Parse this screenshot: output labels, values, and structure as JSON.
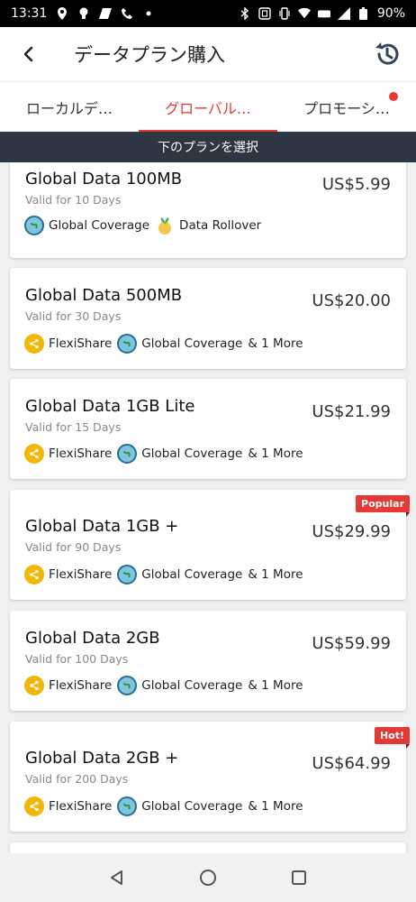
{
  "status_bar": {
    "time": "13:31",
    "battery": "90%"
  },
  "header": {
    "title": "データプラン購入"
  },
  "tabs": [
    {
      "label": "ローカルデ…"
    },
    {
      "label": "グローバル…"
    },
    {
      "label": "プロモーシ…"
    }
  ],
  "section_label": "下のプランを選択",
  "plans": [
    {
      "name": "Global Data 100MB",
      "validity": "Valid for 10 Days",
      "price": "US$5.99",
      "features": [
        "Global Coverage",
        "Data Rollover"
      ],
      "more": "",
      "badge": ""
    },
    {
      "name": "Global Data 500MB",
      "validity": "Valid for 30 Days",
      "price": "US$20.00",
      "features": [
        "FlexiShare",
        "Global Coverage"
      ],
      "more": "& 1 More",
      "badge": ""
    },
    {
      "name": "Global Data 1GB Lite",
      "validity": "Valid for 15 Days",
      "price": "US$21.99",
      "features": [
        "FlexiShare",
        "Global Coverage"
      ],
      "more": "& 1 More",
      "badge": ""
    },
    {
      "name": "Global Data 1GB +",
      "validity": "Valid for 90 Days",
      "price": "US$29.99",
      "features": [
        "FlexiShare",
        "Global Coverage"
      ],
      "more": "& 1 More",
      "badge": "Popular"
    },
    {
      "name": "Global Data 2GB",
      "validity": "Valid for 100 Days",
      "price": "US$59.99",
      "features": [
        "FlexiShare",
        "Global Coverage"
      ],
      "more": "& 1 More",
      "badge": ""
    },
    {
      "name": "Global Data 2GB +",
      "validity": "Valid for 200 Days",
      "price": "US$64.99",
      "features": [
        "FlexiShare",
        "Global Coverage"
      ],
      "more": "& 1 More",
      "badge": "Hot!"
    }
  ],
  "colors": {
    "accent": "#e53935",
    "section_bar": "#2e3543"
  }
}
